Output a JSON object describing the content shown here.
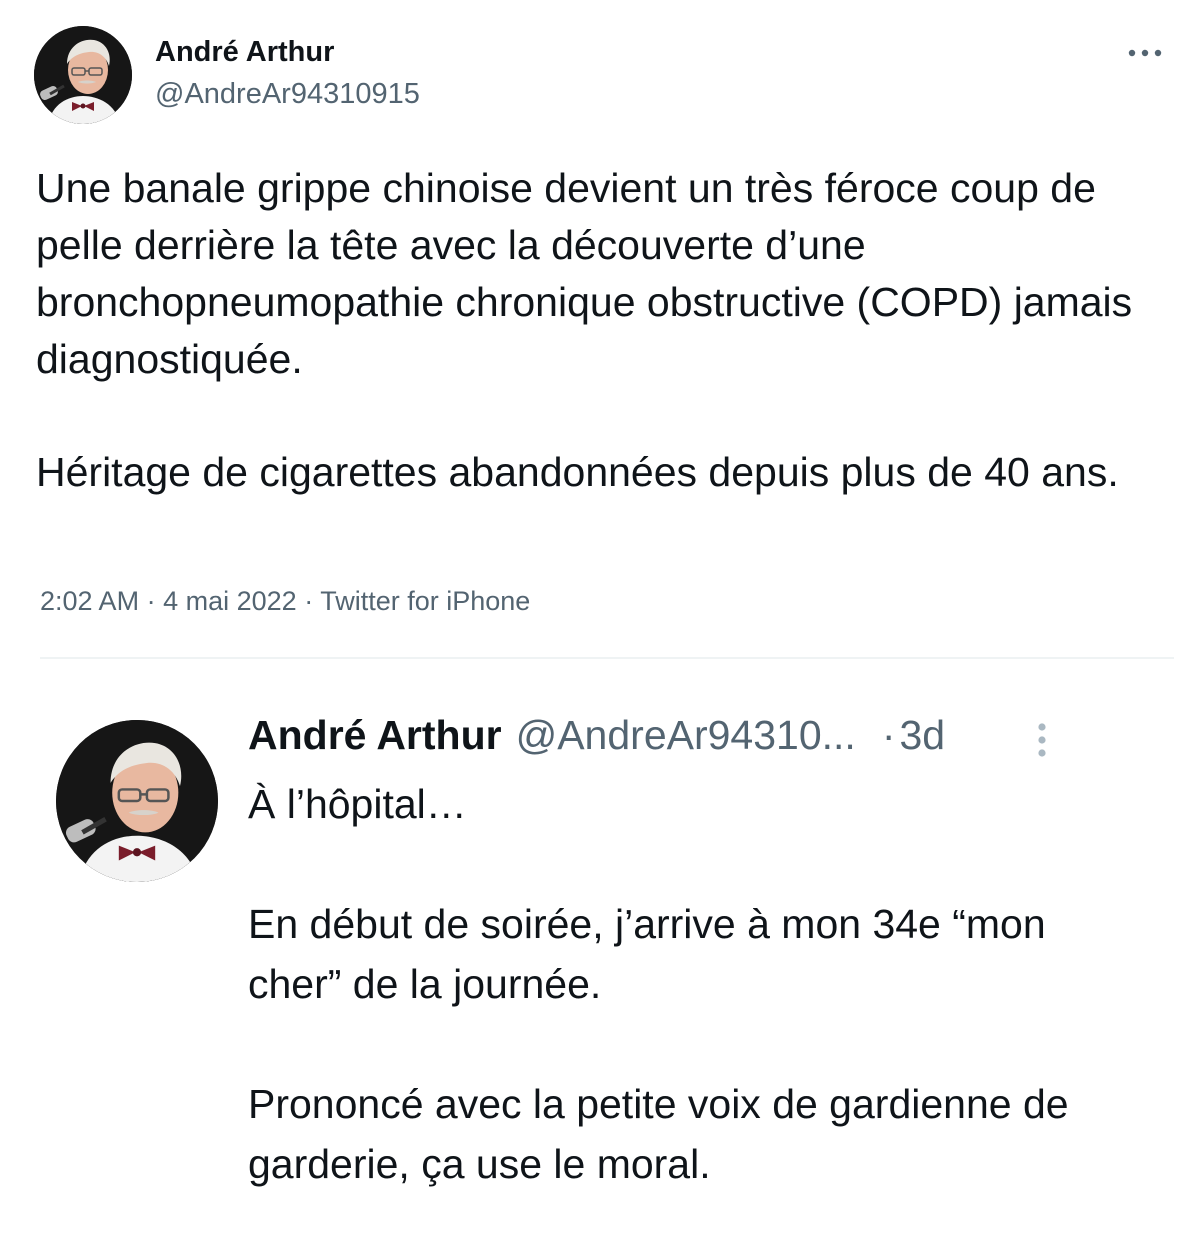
{
  "main_tweet": {
    "author_name": "André Arthur",
    "author_handle": "@AndreAr94310915",
    "paragraphs": [
      "Une banale grippe chinoise devient un très féroce coup de pelle derrière la tête avec la découverte d’une bronchopneumopathie chronique obstructive (COPD) jamais diagnostiquée.",
      "Héritage de cigarettes abandonnées depuis plus de 40 ans."
    ],
    "time": "2:02 AM",
    "date": "4 mai 2022",
    "source": "Twitter for iPhone",
    "separator": "·",
    "more_icon": "more-horizontal-icon"
  },
  "reply_tweet": {
    "author_name": "André Arthur",
    "author_handle": "@AndreAr94310...",
    "separator": "·",
    "relative_time": "3d",
    "more_icon": "more-vertical-icon",
    "paragraphs": [
      "À l’hôpital…",
      "En début de soirée, j’arrive à mon 34e “mon cher” de la journée.",
      "Prononcé avec la petite voix de gardienne de garderie, ça use le moral."
    ]
  },
  "colors": {
    "text_primary": "#0f1419",
    "text_secondary": "#536471",
    "divider": "#eff3f4",
    "background": "#ffffff"
  }
}
